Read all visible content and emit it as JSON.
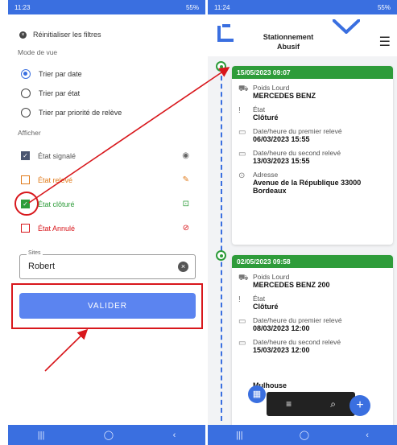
{
  "left": {
    "status": {
      "time": "11:23",
      "battery": "55%"
    },
    "reset_label": "Réinitialiser les filtres",
    "view_mode_title": "Mode de vue",
    "view_options": [
      "Trier par date",
      "Trier par état",
      "Trier par priorité de relève"
    ],
    "show_title": "Afficher",
    "states": [
      "État signalé",
      "État relevé",
      "État clôturé",
      "État Annulé"
    ],
    "state_colors": [
      "#555555",
      "#e07a1a",
      "#2e9c3a",
      "#d8171c"
    ],
    "sites_legend": "Sites",
    "sites_value": "Robert",
    "validate_label": "VALIDER"
  },
  "right": {
    "status": {
      "time": "11:24",
      "battery": "55%"
    },
    "title_line1": "Stationnement",
    "title_line2": "Abusif",
    "card1": {
      "date": "15/05/2023 09:07",
      "vehicle_type": "Poids Lourd",
      "vehicle": "MERCEDES BENZ",
      "state_label": "État",
      "state": "Clôturé",
      "first_label": "Date/heure du premier relevé",
      "first": "06/03/2023 15:55",
      "second_label": "Date/heure du second relevé",
      "second": "13/03/2023 15:55",
      "address_label": "Adresse",
      "address": "Avenue de la République 33000 Bordeaux"
    },
    "card2": {
      "date": "02/05/2023 09:58",
      "vehicle_type": "Poids Lourd",
      "vehicle": "MERCEDES BENZ 200",
      "state_label": "État",
      "state": "Clôturé",
      "first_label": "Date/heure du premier relevé",
      "first": "08/03/2023 12:00",
      "second_label": "Date/heure du second relevé",
      "second": "15/03/2023 12:00",
      "address": "Mulhouse"
    }
  }
}
